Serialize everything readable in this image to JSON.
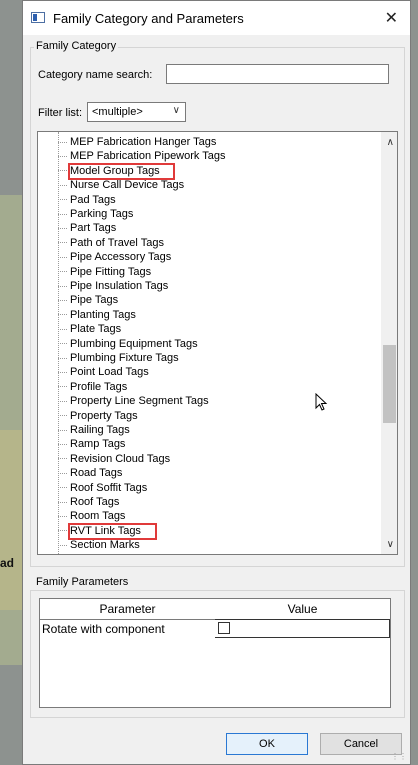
{
  "background": {
    "label": "ad"
  },
  "dialog": {
    "title": "Family Category and Parameters",
    "close_glyph": "✕"
  },
  "family_category": {
    "group_label": "Family Category",
    "search_label": "Category name search:",
    "search_value": "",
    "filter_label": "Filter list:",
    "filter_value": "<multiple>",
    "items": [
      "MEP Fabrication Hanger Tags",
      "MEP Fabrication Pipework Tags",
      "Model Group Tags",
      "Nurse Call Device Tags",
      "Pad Tags",
      "Parking Tags",
      "Part Tags",
      "Path of Travel Tags",
      "Pipe Accessory Tags",
      "Pipe Fitting Tags",
      "Pipe Insulation Tags",
      "Pipe Tags",
      "Planting Tags",
      "Plate Tags",
      "Plumbing Equipment Tags",
      "Plumbing Fixture Tags",
      "Point Load Tags",
      "Profile Tags",
      "Property Line Segment Tags",
      "Property Tags",
      "Railing Tags",
      "Ramp Tags",
      "Revision Cloud Tags",
      "Road Tags",
      "Roof Soffit Tags",
      "Roof Tags",
      "Room Tags",
      "RVT Link Tags",
      "Section Marks"
    ],
    "highlighted": [
      "Model Group Tags",
      "RVT Link Tags"
    ]
  },
  "family_parameters": {
    "group_label": "Family Parameters",
    "columns": [
      "Parameter",
      "Value"
    ],
    "rows": [
      {
        "parameter": "Rotate with component",
        "value_checked": false
      }
    ]
  },
  "buttons": {
    "ok": "OK",
    "cancel": "Cancel"
  },
  "colors": {
    "highlight": "#e03a3a",
    "ok_border": "#2a78d3"
  }
}
